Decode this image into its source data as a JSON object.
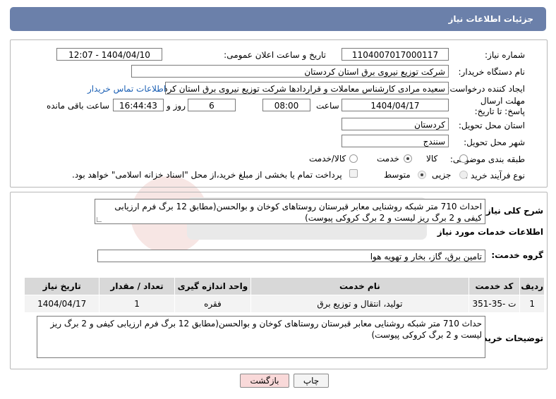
{
  "header": {
    "title": "جزئیات اطلاعات نیاز"
  },
  "form": {
    "need_number_label": "شماره نیاز:",
    "need_number": "1104007017000117",
    "announce_label": "تاریخ و ساعت اعلان عمومی:",
    "announce_value": "1404/04/10 - 12:07",
    "buyer_org_label": "نام دستگاه خریدار:",
    "buyer_org": "شرکت توزیع نیروی برق استان کردستان",
    "creator_label": "ایجاد کننده درخواست:",
    "creator": "سعیده مرادی کارشناس معاملات و قراردادها شرکت توزیع نیروی برق استان کردستان",
    "contact_link": "اطلاعات تماس خریدار",
    "deadline_label": "مهلت ارسال پاسخ: تا تاریخ:",
    "deadline_date": "1404/04/17",
    "time_label": "ساعت",
    "deadline_time": "08:00",
    "days_value": "6",
    "days_label": "روز و",
    "remaining_time": "16:44:43",
    "remaining_label": "ساعت باقی مانده",
    "province_label": "استان محل تحویل:",
    "province": "کردستان",
    "city_label": "شهر محل تحویل:",
    "city": "سنندج",
    "category_label": "طبقه بندی موضوعی:",
    "category_options": [
      "کالا",
      "خدمت",
      "کالا/خدمت"
    ],
    "category_selected": "خدمت",
    "process_label": "نوع فرآیند خرید :",
    "process_options": [
      "جزیی",
      "متوسط"
    ],
    "process_selected": "متوسط",
    "payment_note": "پرداخت تمام یا بخشی از مبلغ خرید،از محل \"اسناد خزانه اسلامی\" خواهد بود."
  },
  "summary": {
    "label": "شرح کلی نیاز:",
    "text": "احداث 710 متر شبکه روشنایی معابر قبرستان روستاهای کوخان و بوالحسن(مطابق 12 برگ فرم ارزیابی کیفی و 2 برگ ریز لیست و 2 برگ کروکی پیوست)"
  },
  "services": {
    "section_title": "اطلاعات خدمات مورد نیاز",
    "group_label": "گروه خدمت:",
    "group_value": "تامین برق، گاز، بخار و تهویه هوا",
    "table": {
      "headers": [
        "ردیف",
        "کد خدمت",
        "نام خدمت",
        "واحد اندازه گیری",
        "تعداد / مقدار",
        "تاریخ نیاز"
      ],
      "rows": [
        [
          "1",
          "ت -35-351",
          "تولید، انتقال و توزیع برق",
          "فقره",
          "1",
          "1404/04/17"
        ]
      ]
    }
  },
  "buyer_notes": {
    "label": "توضیحات خریدار:",
    "text": "حداث 710 متر شبکه روشنایی معابر قبرستان روستاهای کوخان و بوالحسن(مطابق 12 برگ فرم ارزیابی کیفی و 2 برگ ریز لیست و 2 برگ کروکی پیوست)"
  },
  "buttons": {
    "print": "چاپ",
    "back": "بازگشت"
  },
  "colors": {
    "header_bg": "#6b80aa",
    "back_btn_bg": "#f9d9d9",
    "link": "#1a5fb4"
  }
}
